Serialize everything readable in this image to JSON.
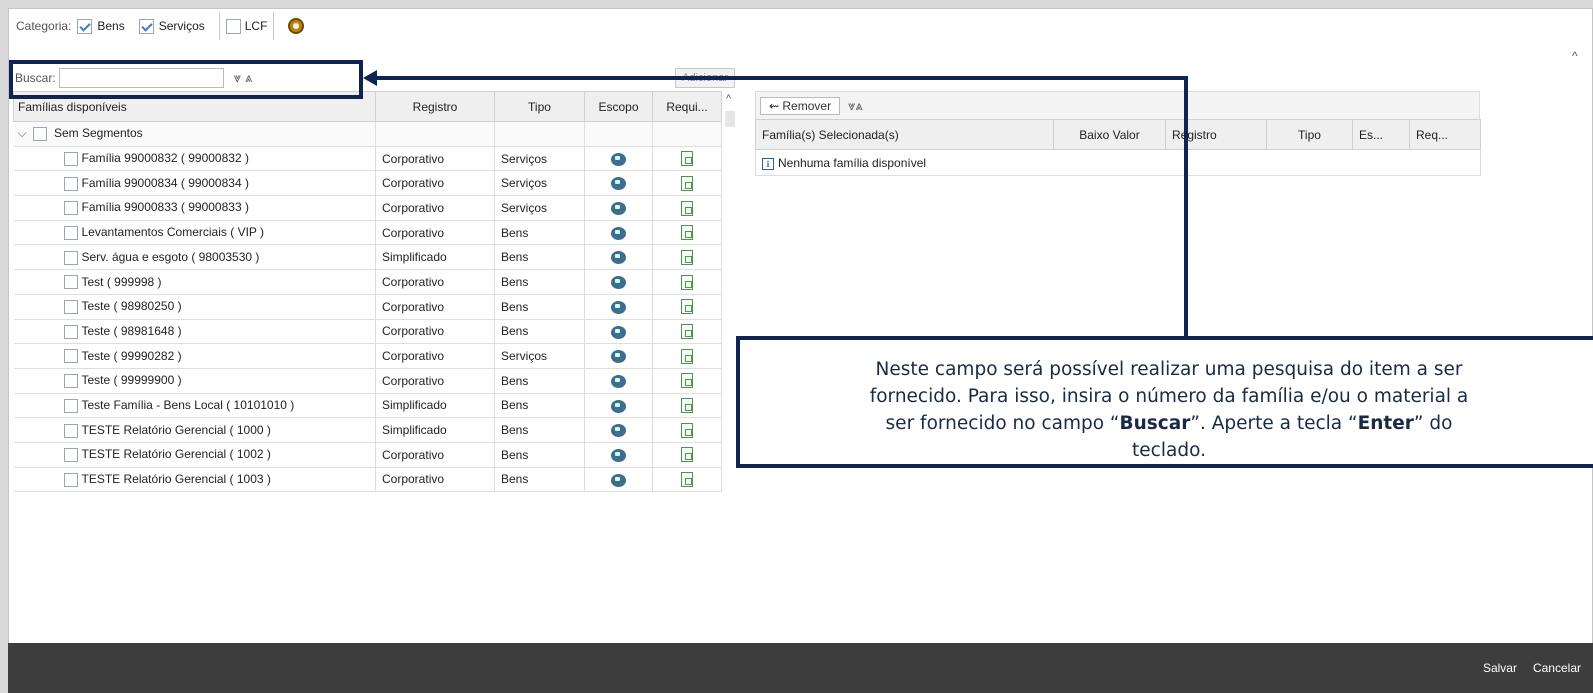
{
  "category": {
    "label": "Categoria:",
    "options": [
      {
        "label": "Bens",
        "checked": true
      },
      {
        "label": "Serviços",
        "checked": true
      },
      {
        "label": "LCF",
        "checked": false
      }
    ]
  },
  "search": {
    "label": "Buscar:",
    "value": ""
  },
  "add_button": "Adicionar",
  "left_table": {
    "headers": [
      "Famílias disponíveis",
      "Registro",
      "Tipo",
      "Escopo",
      "Requi..."
    ],
    "group": "Sem Segmentos",
    "rows": [
      {
        "name": "Família 99000832 ( 99000832 )",
        "registro": "Corporativo",
        "tipo": "Serviços"
      },
      {
        "name": "Família 99000834 ( 99000834 )",
        "registro": "Corporativo",
        "tipo": "Serviços"
      },
      {
        "name": "Família 99000833 ( 99000833 )",
        "registro": "Corporativo",
        "tipo": "Serviços"
      },
      {
        "name": "Levantamentos Comerciais ( VIP )",
        "registro": "Corporativo",
        "tipo": "Bens"
      },
      {
        "name": "Serv. água e esgoto ( 98003530 )",
        "registro": "Simplificado",
        "tipo": "Bens"
      },
      {
        "name": "Test ( 999998 )",
        "registro": "Corporativo",
        "tipo": "Bens"
      },
      {
        "name": "Teste ( 98980250 )",
        "registro": "Corporativo",
        "tipo": "Bens"
      },
      {
        "name": "Teste ( 98981648 )",
        "registro": "Corporativo",
        "tipo": "Bens"
      },
      {
        "name": "Teste ( 99990282 )",
        "registro": "Corporativo",
        "tipo": "Serviços"
      },
      {
        "name": "Teste ( 99999900 )",
        "registro": "Corporativo",
        "tipo": "Bens"
      },
      {
        "name": "Teste Família - Bens Local ( 10101010 )",
        "registro": "Simplificado",
        "tipo": "Bens"
      },
      {
        "name": "TESTE Relatório Gerencial ( 1000 )",
        "registro": "Simplificado",
        "tipo": "Bens"
      },
      {
        "name": "TESTE Relatório Gerencial ( 1002 )",
        "registro": "Corporativo",
        "tipo": "Bens"
      },
      {
        "name": "TESTE Relatório Gerencial ( 1003 )",
        "registro": "Corporativo",
        "tipo": "Bens"
      }
    ]
  },
  "remove_button": "Remover",
  "right_table": {
    "headers": [
      "Família(s) Selecionada(s)",
      "Baixo Valor",
      "Registro",
      "Tipo",
      "Es...",
      "Req..."
    ],
    "empty_message": "Nenhuma família disponível"
  },
  "footer": {
    "save": "Salvar",
    "cancel": "Cancelar"
  },
  "callout": {
    "line1": "Neste campo será possível realizar uma pesquisa do item a ser",
    "line2": "fornecido. Para isso, insira o número da família e/ou o material a",
    "line3_pre": "ser fornecido no campo “",
    "line3_bold1": "Buscar",
    "line3_mid": "”. Aperte a tecla “",
    "line3_bold2": "Enter",
    "line3_post": "” do",
    "line4": "teclado."
  }
}
